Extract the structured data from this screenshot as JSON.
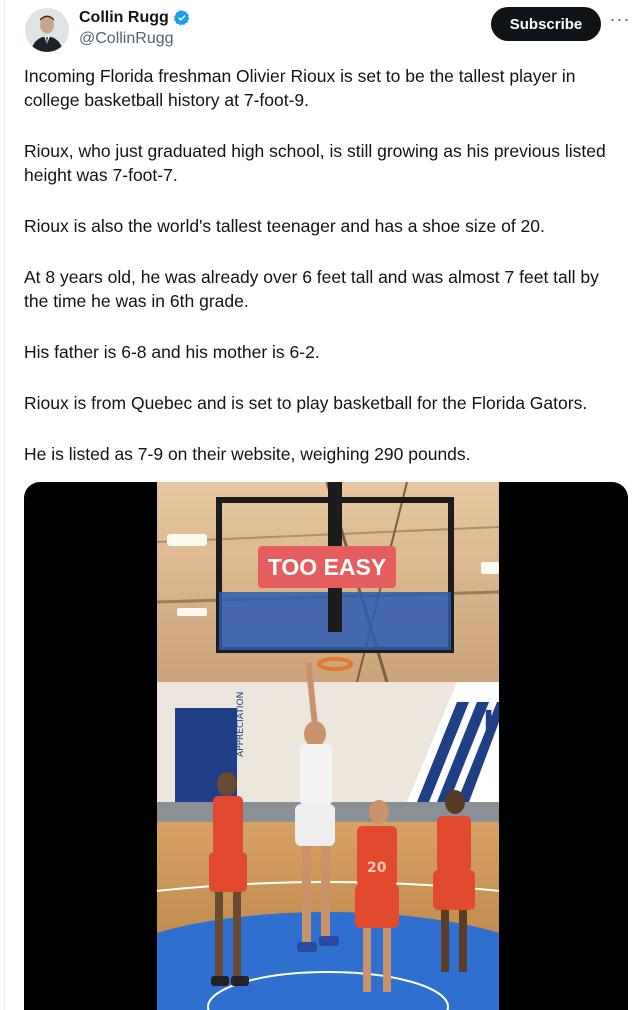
{
  "author": {
    "display_name": "Collin Rugg",
    "handle": "@CollinRugg",
    "verified": true,
    "verified_color": "#1d9bf0"
  },
  "actions": {
    "subscribe_label": "Subscribe",
    "more_label": "···"
  },
  "tweet": {
    "paragraphs": [
      "Incoming Florida freshman Olivier Rioux is set to be the tallest player in college basketball history at 7-foot-9.",
      "Rioux, who just graduated high school, is still growing as his previous listed height was 7-foot-7.",
      "Rioux is also the world's tallest teenager and has a shoe size of 20.",
      "At 8 years old, he was already over 6 feet tall and was almost 7 feet tall by the time he was in 6th grade.",
      "His father is 6-8 and his mother is 6-2.",
      "Rioux is from Quebec and is set to play basketball for the Florida Gators.",
      "He is listed as 7-9 on their website, weighing 290 pounds."
    ]
  },
  "media": {
    "overlay_text": "TOO EASY",
    "overlay_color": "#e65d5d",
    "banner_text": "APPRECIATION",
    "jersey_number": "20",
    "wall_text": "I"
  }
}
